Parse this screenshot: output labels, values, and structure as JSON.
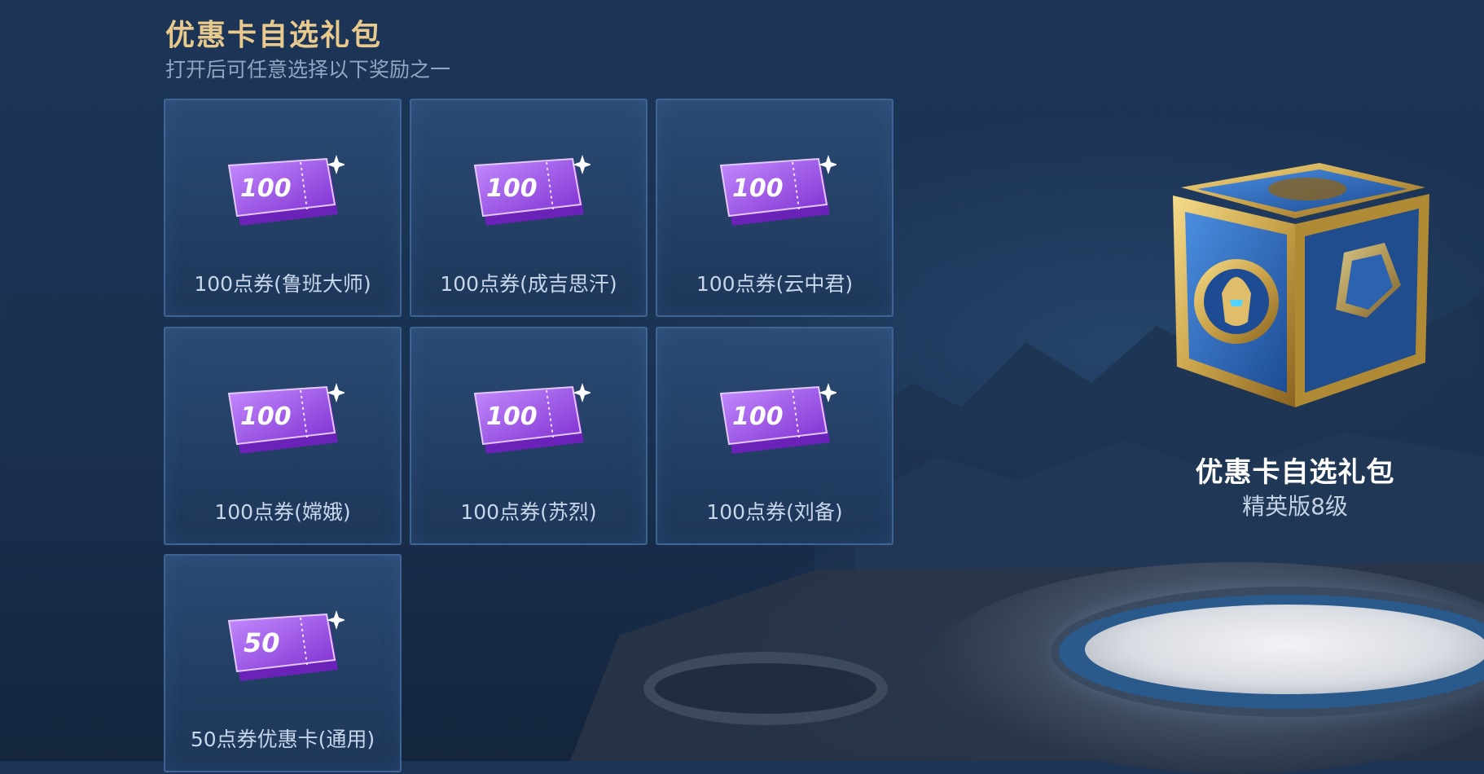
{
  "header": {
    "title": "优惠卡自选礼包",
    "subtitle": "打开后可任意选择以下奖励之一"
  },
  "rewards": [
    {
      "label": "100点券(鲁班大师)",
      "value": "100",
      "icon": "voucher-ticket-icon"
    },
    {
      "label": "100点券(成吉思汗)",
      "value": "100",
      "icon": "voucher-ticket-icon"
    },
    {
      "label": "100点券(云中君)",
      "value": "100",
      "icon": "voucher-ticket-icon"
    },
    {
      "label": "100点券(嫦娥)",
      "value": "100",
      "icon": "voucher-ticket-icon"
    },
    {
      "label": "100点券(苏烈)",
      "value": "100",
      "icon": "voucher-ticket-icon"
    },
    {
      "label": "100点券(刘备)",
      "value": "100",
      "icon": "voucher-ticket-icon"
    },
    {
      "label": "50点券优惠卡(通用)",
      "value": "50",
      "icon": "voucher-ticket-icon"
    }
  ],
  "gift": {
    "title": "优惠卡自选礼包",
    "subtitle": "精英版8级",
    "icon": "treasure-chest-icon"
  },
  "colors": {
    "title_gold": "#e8c98e",
    "ticket_purple": "#9b4fe0",
    "card_border": "#3d6494"
  }
}
